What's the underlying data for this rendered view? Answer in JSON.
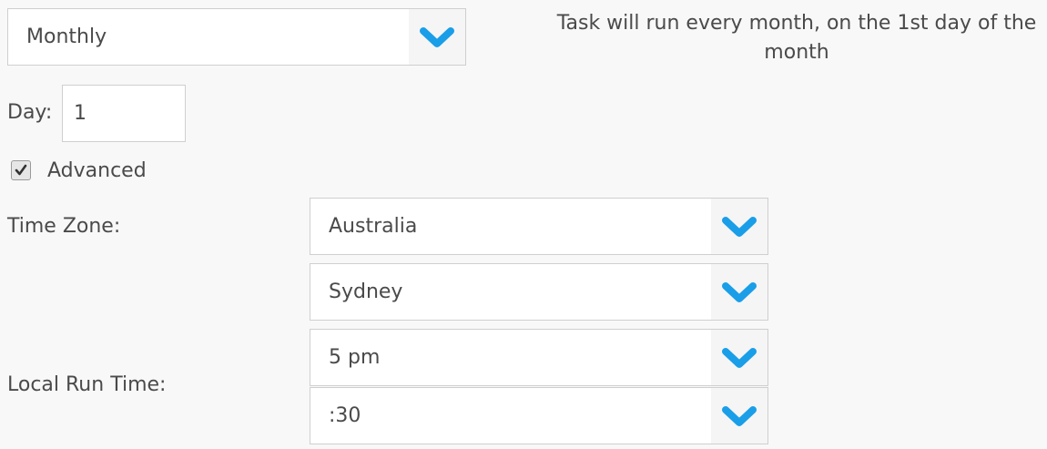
{
  "frequency": {
    "selected": "Monthly",
    "description": "Task will run every month, on the 1st day of the month"
  },
  "day": {
    "label": "Day:",
    "value": "1"
  },
  "advanced": {
    "label": "Advanced",
    "checked": true
  },
  "time_zone": {
    "label": "Time Zone:",
    "region": "Australia",
    "city": "Sydney"
  },
  "run_time": {
    "label": "Local Run Time:",
    "hour": "5 pm",
    "minute": ":30"
  },
  "colors": {
    "chevron": "#1a9ee8",
    "background": "#f8f8f8",
    "border": "#cfcfcf"
  }
}
